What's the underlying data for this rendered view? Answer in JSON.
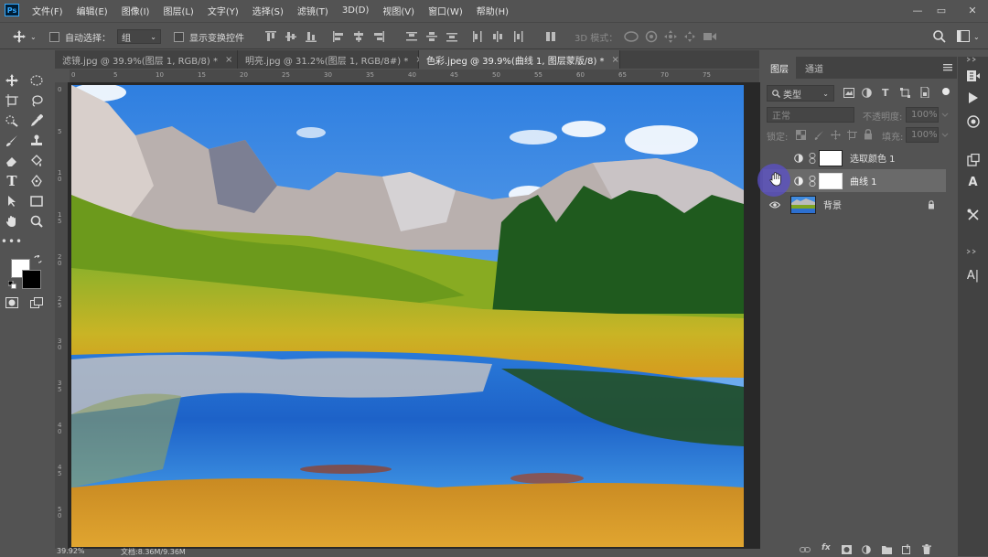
{
  "app": {
    "logo": "Ps"
  },
  "menu": [
    "文件(F)",
    "编辑(E)",
    "图像(I)",
    "图层(L)",
    "文字(Y)",
    "选择(S)",
    "滤镜(T)",
    "3D(D)",
    "视图(V)",
    "窗口(W)",
    "帮助(H)"
  ],
  "window_controls": {
    "minimize": "—",
    "maximize": "▭",
    "close": "✕"
  },
  "options": {
    "auto_select_label": "自动选择：",
    "auto_select_value": "组",
    "show_transform_label": "显示变换控件",
    "mode_3d_label": "3D 模式："
  },
  "tabs": [
    {
      "label": "滤镜.jpg @ 39.9%(图层 1, RGB/8) *",
      "close": "×"
    },
    {
      "label": "明亮.jpg @ 31.2%(图层 1, RGB/8#) *",
      "close": "×"
    },
    {
      "label": "色彩.jpeg @ 39.9%(曲线 1, 图层蒙版/8) *",
      "close": "×"
    }
  ],
  "ruler": {
    "top": [
      "0",
      "5",
      "10",
      "15",
      "20",
      "25",
      "30",
      "35",
      "40",
      "45",
      "50",
      "55",
      "60",
      "65",
      "70",
      "75"
    ],
    "left": [
      "0",
      "5",
      "1\n0",
      "1\n5",
      "2\n0",
      "2\n5",
      "3\n0",
      "3\n5",
      "4\n0",
      "4\n5",
      "5\n0"
    ]
  },
  "status": {
    "zoom": "39.92%",
    "doc": "文档:8.36M/9.36M"
  },
  "layers_panel": {
    "tab_layers": "图层",
    "tab_channels": "通道",
    "filter_type": "类型",
    "blend_mode": "正常",
    "opacity_label": "不透明度:",
    "opacity_value": "100%",
    "lock_label": "锁定:",
    "fill_label": "填充:",
    "fill_value": "100%",
    "layers": [
      {
        "name": "选取颜色 1",
        "visible": false,
        "selected": false
      },
      {
        "name": "曲线 1",
        "visible": false,
        "selected": true
      },
      {
        "name": "背景",
        "visible": true,
        "selected": false
      }
    ]
  },
  "right_strip_text_tool": "A|"
}
